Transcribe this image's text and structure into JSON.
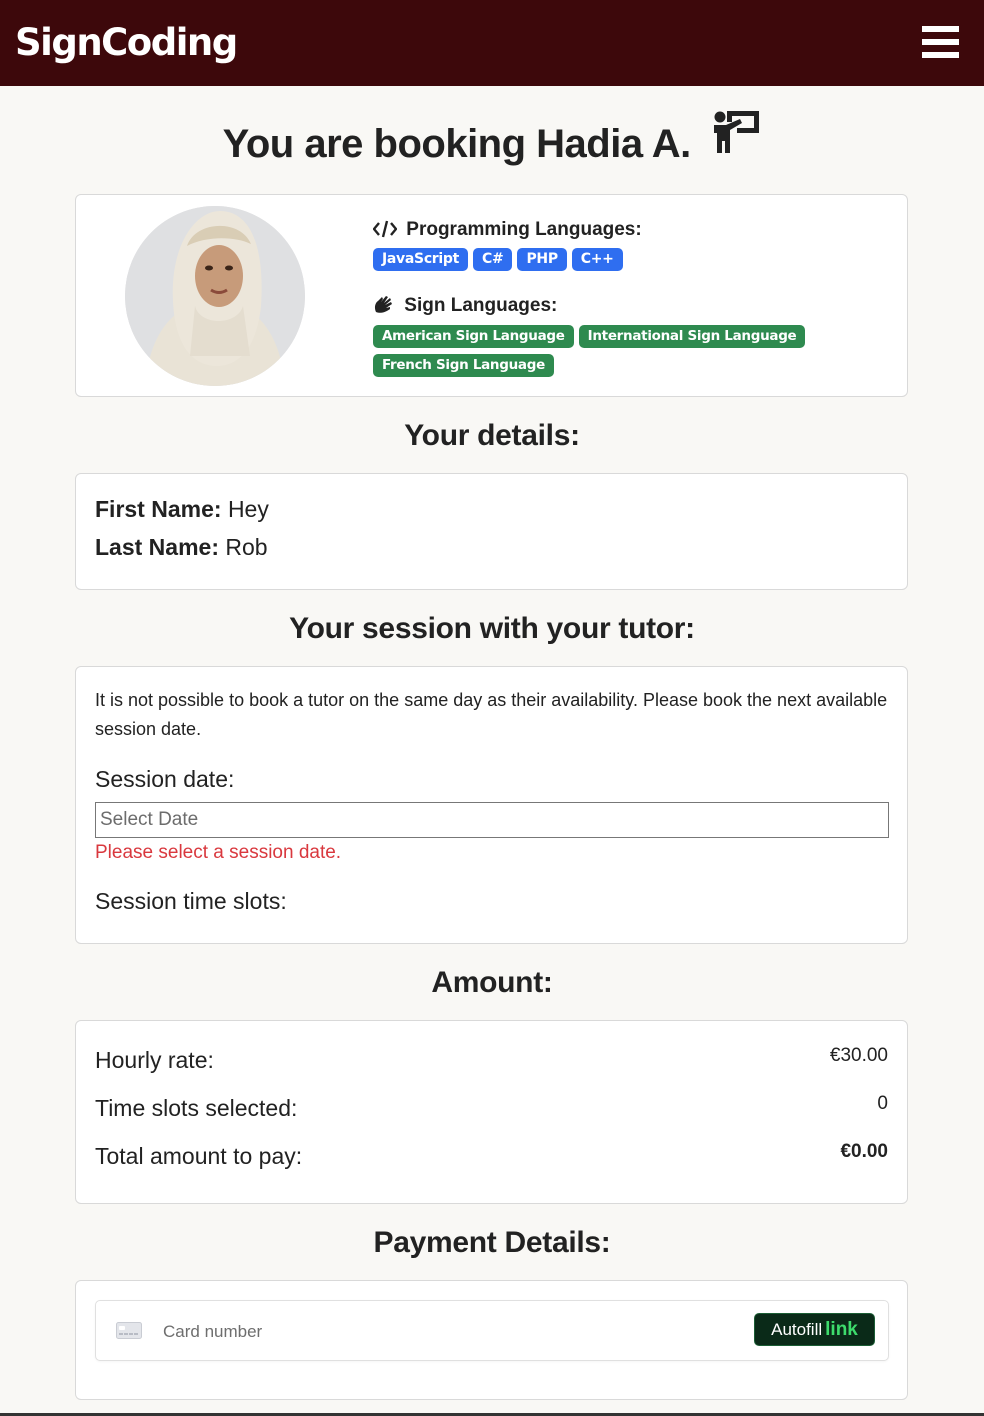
{
  "navbar": {
    "brand": "SignCoding",
    "menu_icon": "hamburger-menu-icon"
  },
  "page": {
    "title": "You are booking Hadia A.",
    "title_icon": "chalkboard-teacher-icon"
  },
  "tutor": {
    "avatar": "tutor-photo",
    "programming_heading": "Programming Languages:",
    "programming_icon": "code-icon",
    "programming_languages": [
      "JavaScript",
      "C#",
      "PHP",
      "C++"
    ],
    "sign_heading": "Sign Languages:",
    "sign_icon": "hands-signing-icon",
    "sign_languages": [
      "American Sign Language",
      "International Sign Language",
      "French Sign Language"
    ]
  },
  "details": {
    "heading": "Your details:",
    "first_name_label": "First Name:",
    "first_name": "Hey",
    "last_name_label": "Last Name:",
    "last_name": "Rob"
  },
  "session": {
    "heading": "Your session with your tutor:",
    "notice": "It is not possible to book a tutor on the same day as their availability. Please book the next available session date.",
    "date_label": "Session date:",
    "date_placeholder": "Select Date",
    "date_value": "",
    "error": "Please select a session date.",
    "slots_label": "Session time slots:"
  },
  "amount": {
    "heading": "Amount:",
    "hourly_rate_label": "Hourly rate:",
    "hourly_rate": "€30.00",
    "slots_selected_label": "Time slots selected:",
    "slots_selected": "0",
    "total_label": "Total amount to pay:",
    "total": "€0.00"
  },
  "payment": {
    "heading": "Payment Details:",
    "card_placeholder": "Card number",
    "card_icon": "credit-card-icon",
    "autofill_label": "Autofill",
    "autofill_link": "link"
  },
  "colors": {
    "navbar": "#3d080b",
    "badge_blue": "#2f6ef0",
    "badge_green": "#2e8a4f",
    "error": "#d9383e",
    "autofill_bg": "#0a2a18",
    "link_green": "#3ddc6c"
  }
}
